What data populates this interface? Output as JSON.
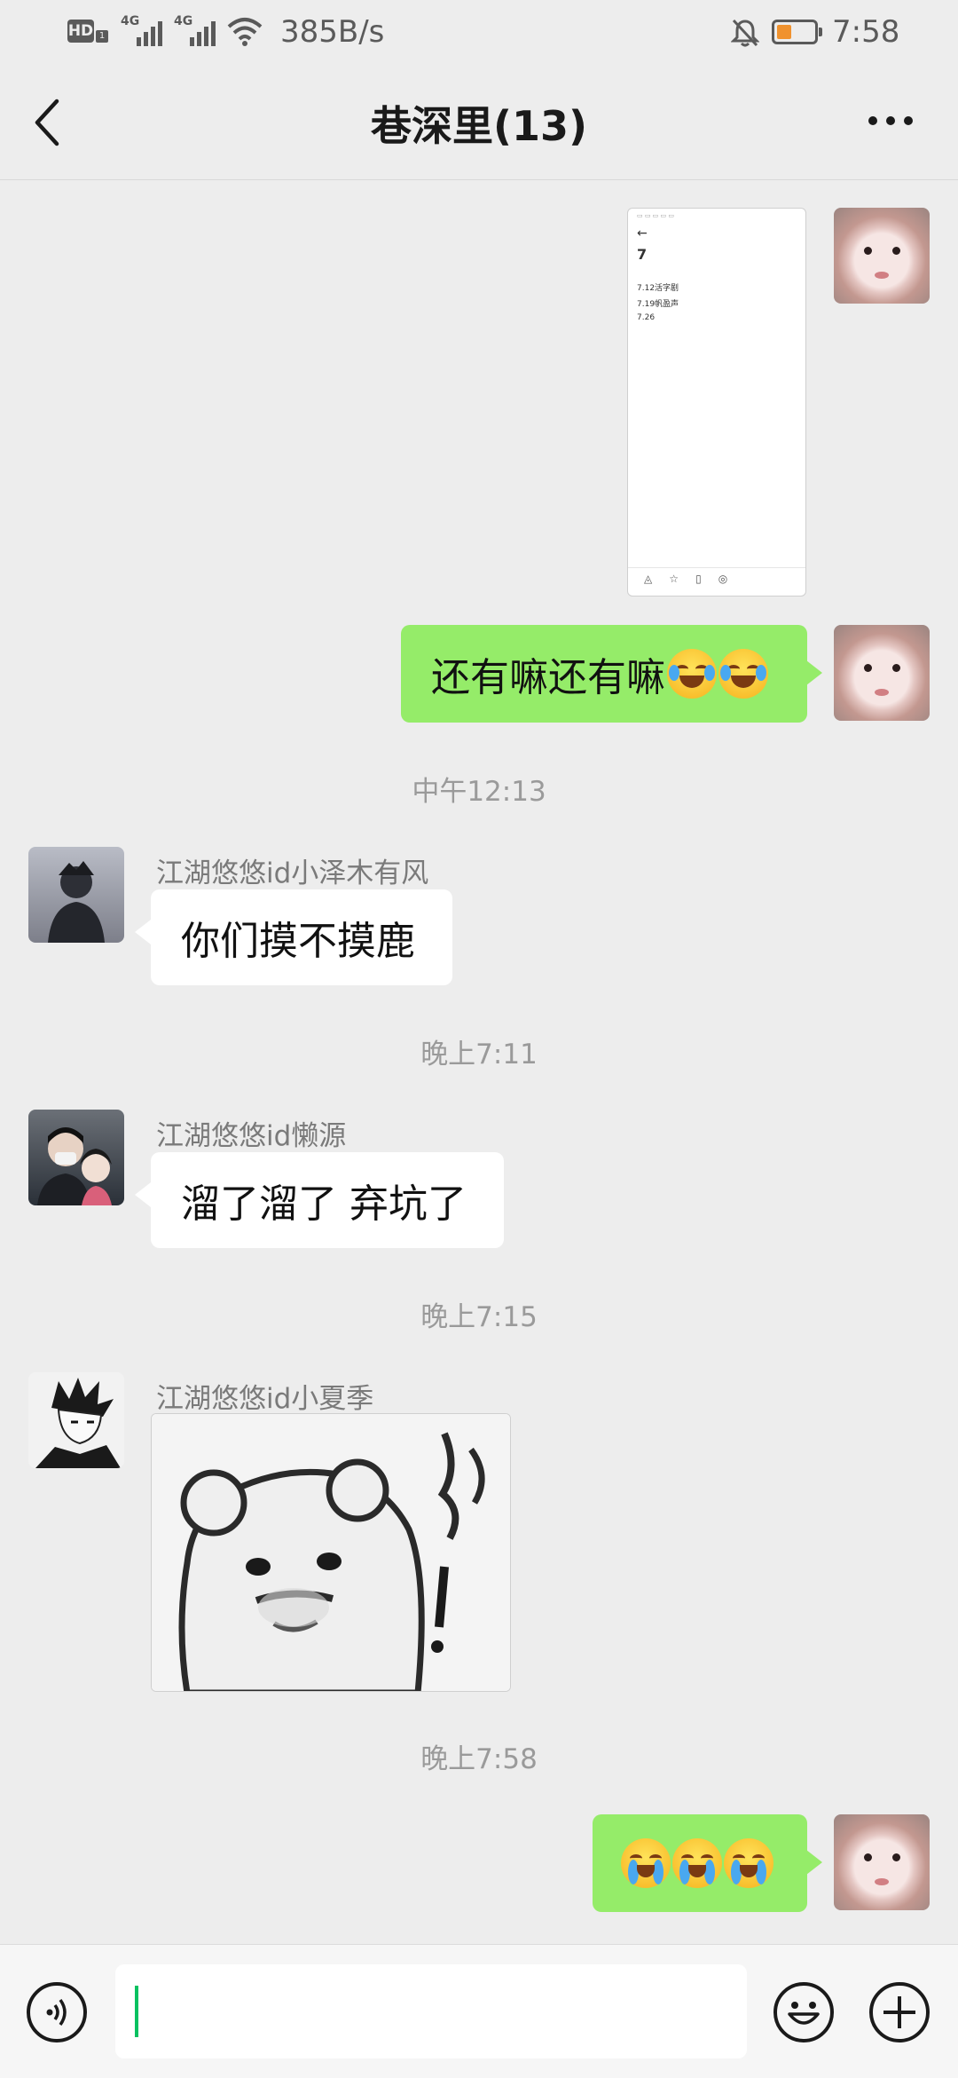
{
  "status_bar": {
    "hd_label": "HD",
    "hd_sub": "1",
    "net_label_1": "4G",
    "net_label_2": "4G",
    "speed": "385B/s",
    "time": "7:58",
    "battery_color": "#f0922e"
  },
  "nav": {
    "back_icon": "chevron-left-icon",
    "title": "巷深里(13)",
    "more_icon": "more-dots-icon"
  },
  "messages": {
    "m1": {
      "type": "image",
      "direction": "outgoing",
      "thumb_lines": [
        "7",
        "7.12活字剧",
        "7.19帆盈声",
        "7.26"
      ]
    },
    "m2": {
      "type": "text",
      "direction": "outgoing",
      "text": "还有嘛还有嘛",
      "emoji": "face-with-tears-of-joy"
    },
    "t1": "中午12:13",
    "m3": {
      "type": "text",
      "direction": "incoming",
      "sender": "江湖悠悠id小泽木有风",
      "text": "你们摸不摸鹿"
    },
    "t2": "晚上7:11",
    "m4": {
      "type": "text",
      "direction": "incoming",
      "sender": "江湖悠悠id懒源",
      "text": "溜了溜了 弃坑了"
    },
    "t3": "晚上7:15",
    "m5": {
      "type": "sticker",
      "direction": "incoming",
      "sender": "江湖悠悠id小夏季"
    },
    "t4": "晚上7:58",
    "m6": {
      "type": "emoji",
      "direction": "outgoing",
      "emoji": "loudly-crying-face",
      "count": 3
    }
  },
  "input_bar": {
    "voice_icon": "voice-icon",
    "emoji_icon": "smiley-icon",
    "plus_icon": "plus-icon",
    "value": "",
    "cursor_color": "#07c160"
  },
  "colors": {
    "background": "#ededed",
    "outgoing_bubble": "#95ec69",
    "incoming_bubble": "#ffffff"
  }
}
